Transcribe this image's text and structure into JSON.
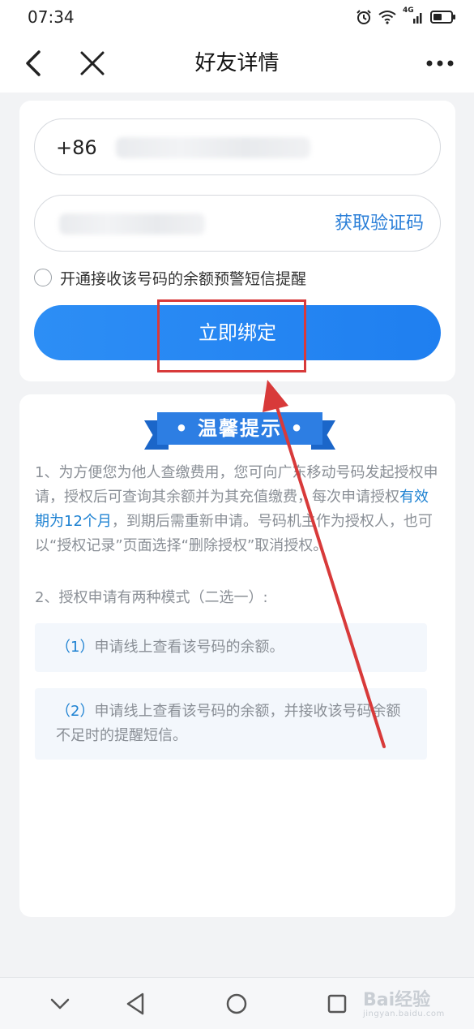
{
  "status_bar": {
    "time": "07:34",
    "network_label": "4G"
  },
  "nav": {
    "title": "好友详情"
  },
  "form": {
    "phone_prefix": "+86",
    "get_code_label": "获取验证码",
    "alert_option_label": "开通接收该号码的余额预警短信提醒",
    "bind_button_label": "立即绑定"
  },
  "tips": {
    "banner": "• 温馨提示 •",
    "tip1_part1": "1、为方便您为他人查缴费用，您可向广东移动号码发起授权申请，授权后可查询其余额并为其充值缴费，每次申请授权",
    "tip1_highlight": "有效期为12个月",
    "tip1_part2": "，到期后需重新申请。号码机主作为授权人，也可以“授权记录”页面选择“删除授权”取消授权。",
    "tip2": "2、授权申请有两种模式（二选一）:",
    "mode1_num": "（1）",
    "mode1_text": "申请线上查看该号码的余额。",
    "mode2_num": "（2）",
    "mode2_text": "申请线上查看该号码的余额，并接收该号码余额不足时的提醒短信。"
  },
  "watermark": {
    "logo": "Bai经验",
    "url": "jingyan.baidu.com"
  },
  "colors": {
    "accent": "#2d8ef5",
    "link": "#1e82d2",
    "annotation": "#d83a3a"
  }
}
